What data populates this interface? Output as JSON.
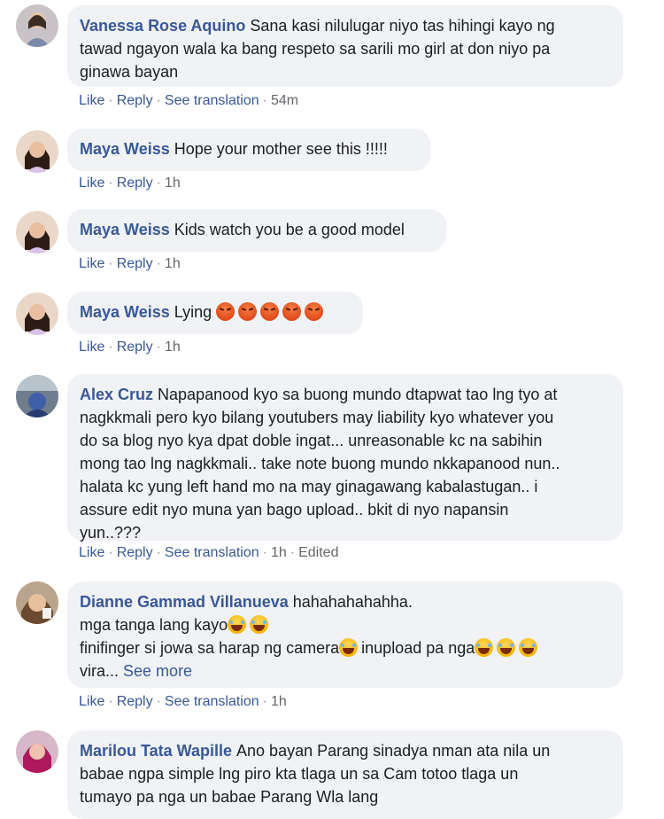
{
  "comments": [
    {
      "name": "Vanessa Rose Aquino",
      "text_lines": [
        "Sana kasi nilulugar niyo tas hihingi kayo ng",
        "tawad ngayon wala ka bang respeto sa sarili mo girl at don niyo pa",
        "ginawa bayan"
      ],
      "actions": {
        "like": "Like",
        "reply": "Reply",
        "translate": "See translation",
        "time": "54m"
      }
    },
    {
      "name": "Maya Weiss",
      "text": "Hope your mother see this !!!!!",
      "actions": {
        "like": "Like",
        "reply": "Reply",
        "time": "1h"
      }
    },
    {
      "name": "Maya Weiss",
      "text": "Kids watch you be a good model",
      "actions": {
        "like": "Like",
        "reply": "Reply",
        "time": "1h"
      }
    },
    {
      "name": "Maya Weiss",
      "text": "Lying",
      "emoji": [
        "angry-face",
        "angry-face",
        "angry-face",
        "angry-face",
        "angry-face"
      ],
      "actions": {
        "like": "Like",
        "reply": "Reply",
        "time": "1h"
      }
    },
    {
      "name": "Alex Cruz",
      "text_lines": [
        "Napapanood kyo sa buong mundo dtapwat tao lng tyo at",
        "nagkkmali pero kyo bilang youtubers may liability kyo whatever you",
        "do sa blog nyo kya dpat doble ingat... unreasonable kc na sabihin",
        "mong tao lng nagkkmali.. take note buong mundo nkkapanood nun..",
        "halata kc yung left hand mo na may ginagawang kabalastugan.. i",
        "assure edit nyo muna yan bago upload.. bkit di nyo napansin",
        "yun..???"
      ],
      "actions": {
        "like": "Like",
        "reply": "Reply",
        "translate": "See translation",
        "time": "1h",
        "edited": "Edited"
      }
    },
    {
      "name": "Dianne Gammad Villanueva",
      "line1": "hahahahahahha.",
      "line2": "mga tanga lang kayo",
      "line3a": "finifinger si jowa sa harap ng camera",
      "line3b": "inupload pa nga",
      "line4": "vira...",
      "see_more": "See more",
      "actions": {
        "like": "Like",
        "reply": "Reply",
        "translate": "See translation",
        "time": "1h"
      }
    },
    {
      "name": "Marilou Tata Wapille",
      "text_lines": [
        "Ano bayan Parang sinadya nman ata nila un",
        "babae ngpa simple lng piro kta tlaga un sa Cam totoo tlaga un",
        "tumayo pa nga un babae Parang Wla lang"
      ]
    }
  ],
  "colors": {
    "name": "#385898",
    "bubble": "#f0f2f5",
    "meta": "#65676b"
  }
}
